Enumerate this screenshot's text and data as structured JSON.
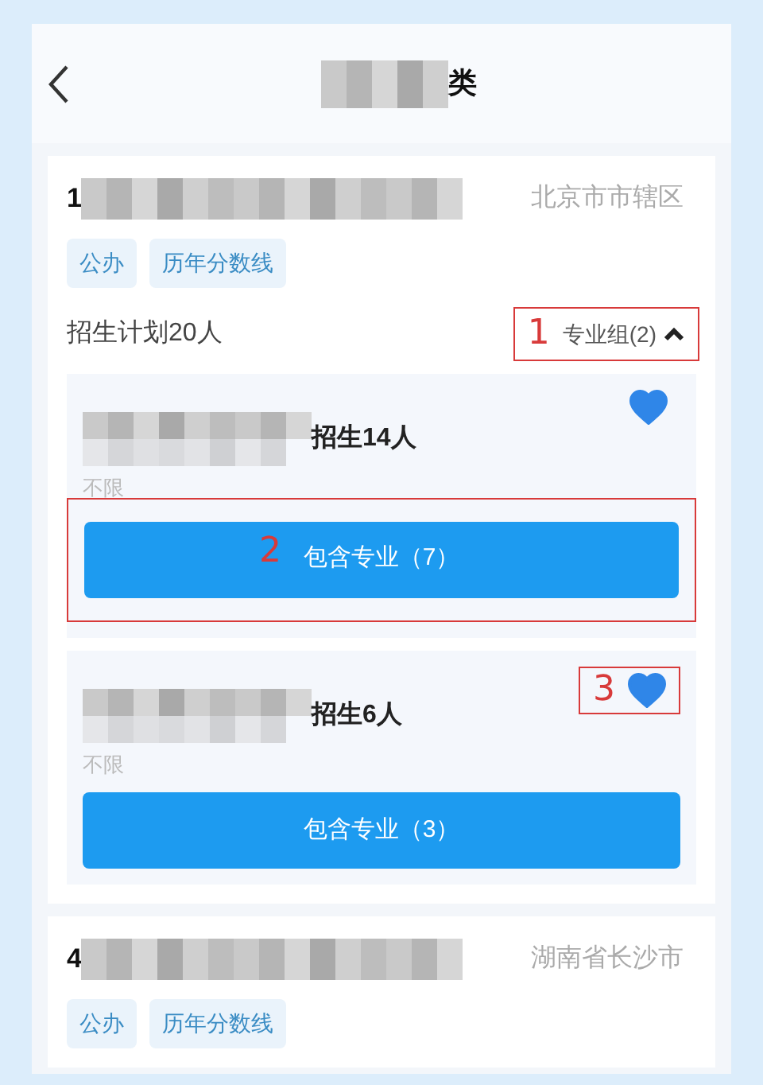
{
  "header": {
    "title_suffix": "类"
  },
  "schools": [
    {
      "number_prefix": "1",
      "location": "北京市市辖区",
      "tags": [
        "公办",
        "历年分数线"
      ],
      "plan": "招生计划20人",
      "group_toggle": {
        "label": "专业组(2)",
        "expanded": true,
        "callout": "1"
      },
      "groups": [
        {
          "enroll": "招生14人",
          "limit": "不限",
          "favorited": true,
          "button": "包含专业（7）",
          "button_callout": "2"
        },
        {
          "enroll": "招生6人",
          "limit": "不限",
          "favorited": true,
          "favorite_callout": "3",
          "button": "包含专业（3）"
        }
      ]
    },
    {
      "number_prefix": "4",
      "location": "湖南省长沙市",
      "tags": [
        "公办",
        "历年分数线"
      ]
    }
  ]
}
